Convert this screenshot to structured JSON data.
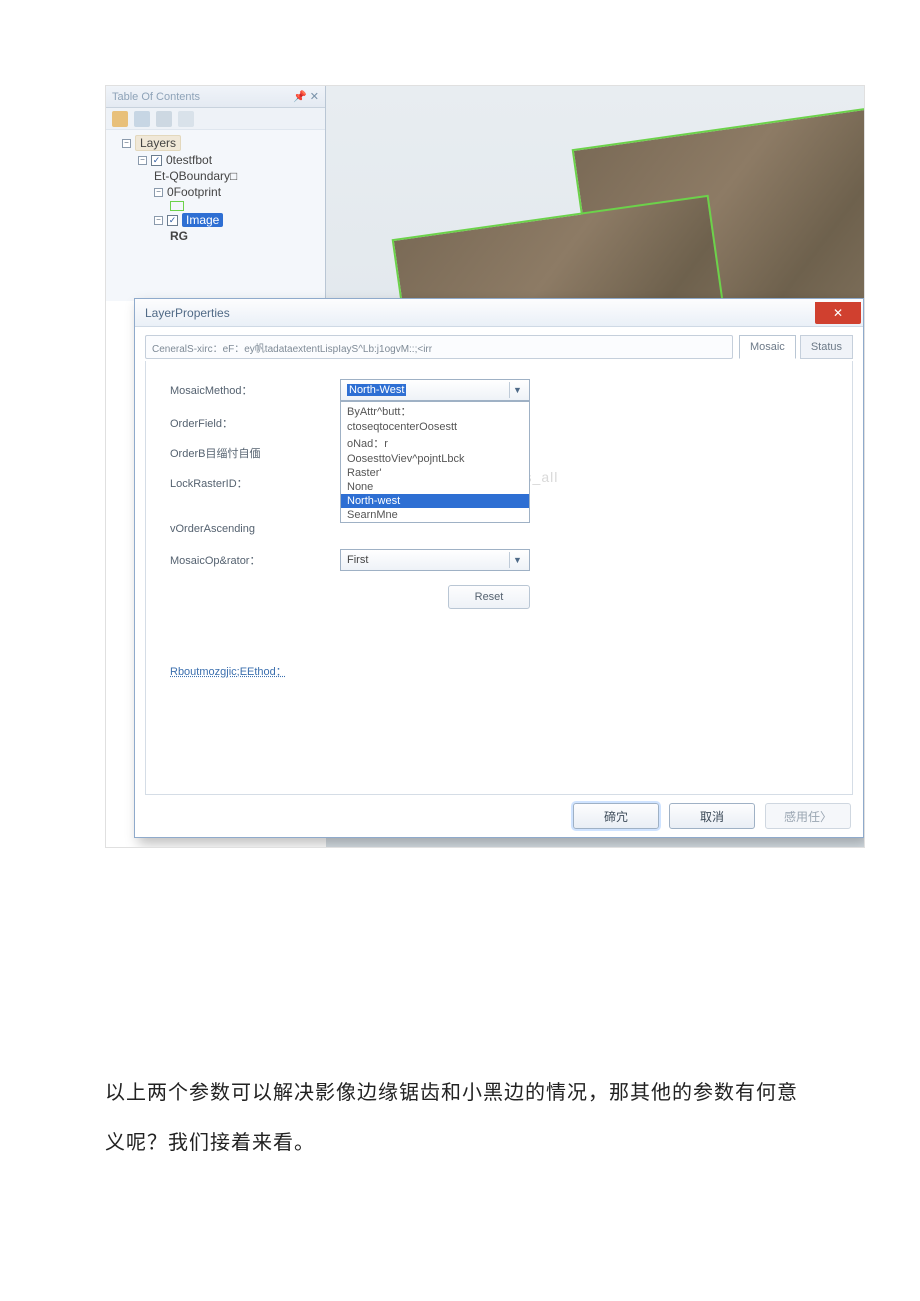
{
  "toc": {
    "title": "Table Of Contents",
    "pin_label": "📌",
    "close_label": "✕",
    "root": "Layers",
    "items": [
      "0testfbot",
      "Et-QBoundary□",
      "0Footprint",
      "Image",
      "RG"
    ]
  },
  "dialog": {
    "title": "LayerProperties",
    "tabstrip_text": "CeneralS-xirc：eF：ey帆tadataextentLispIayS^Lb:j1ogvM::;<irr",
    "tab_active": "Mosaic",
    "tab_status": "Status",
    "labels": {
      "mosaic_method": "MosaicMethod：",
      "order_field": "OrderField：",
      "order_base": "OrderB目缁忖自偭",
      "lock_raster": "LockRasterID：",
      "order_asc": "vOrderAscending",
      "mosaic_operator": "MosaicOp&rator：",
      "about": "Rboutmozgjic;EEthod："
    },
    "mosaic_method_value": "North-West",
    "dropdown_items": [
      "ByAttr^butt：",
      "ctoseqtocenterOosestt",
      "oNad：r",
      "OosesttoViev^pojntLbck",
      "Raster'",
      "None",
      "North-west",
      "SearnMne"
    ],
    "dropdown_selected_index": 6,
    "mosaic_operator_value": "First",
    "reset": "Reset",
    "watermark": "http://blog.csdn.net/arcgis_all",
    "buttons": {
      "ok": "碲宂",
      "cancel": "取消",
      "apply": "感用任〉"
    }
  },
  "body_text": "以上两个参数可以解决影像边缘锯齿和小黑边的情况，那其他的参数有何意义呢？我们接着来看。"
}
